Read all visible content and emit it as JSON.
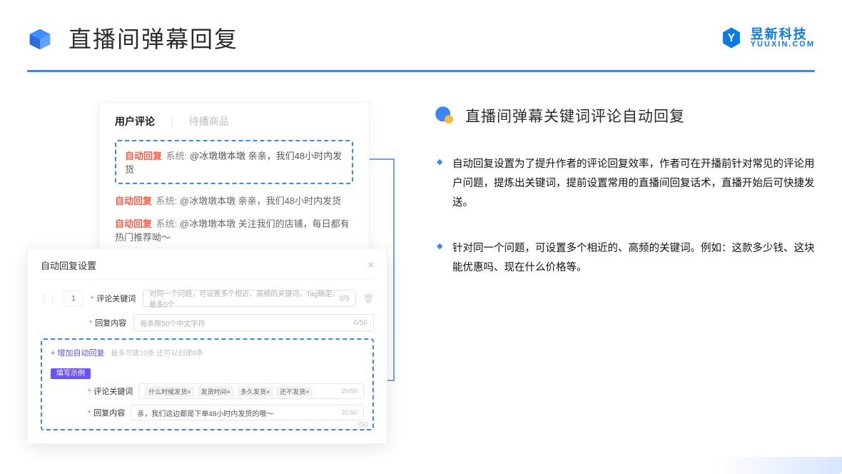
{
  "header": {
    "title": "直播间弹幕回复",
    "brand_cn": "昱新科技",
    "brand_en": "YUUXIN.COM"
  },
  "left": {
    "tabs": {
      "active": "用户评论",
      "other": "待播商品"
    },
    "highlighted_comment": {
      "tag": "自动回复",
      "sys": "系统: ",
      "text": "@冰墩墩本墩 亲亲，我们48小时内发货"
    },
    "comments": [
      {
        "tag": "自动回复",
        "sys": "系统: ",
        "text": "@冰墩墩本墩 亲亲，我们48小时内发货"
      },
      {
        "tag": "自动回复",
        "sys": "系统: ",
        "text": "@冰墩墩本墩 关注我们的店铺，每日都有热门推荐呦～"
      }
    ],
    "settings": {
      "title": "自动回复设置",
      "order": "1",
      "kw_label": "评论关键词",
      "kw_placeholder": "对同一个问题，可设置多个相近、高频的关键词，Tag确定，最多5个",
      "kw_count": "0/5",
      "content_label": "回复内容",
      "content_placeholder": "每条限50个中文字符",
      "content_count": "0/50",
      "add_link": "+ 增加自动回复",
      "add_hint": "最多可建10条 还可以创建9条",
      "example_badge": "填写示例",
      "ex_kw_label": "评论关键词",
      "ex_kw_chips": [
        "什么时候发货×",
        "发货时间×",
        "多久发货×",
        "还不发货×"
      ],
      "ex_kw_count": "20/50",
      "ex_content_label": "回复内容",
      "ex_content_value": "亲，我们这边都是下单48小时内发货的哦～",
      "ex_content_count": "37/50",
      "outer_trail": "/50"
    }
  },
  "right": {
    "section_title": "直播间弹幕关键词评论自动回复",
    "bullets": [
      "自动回复设置为了提升作者的评论回复效率，作者可在开播前针对常见的评论用户问题，提炼出关键词，提前设置常用的直播间回复话术，直播开始后可快捷发送。",
      "针对同一个问题，可设置多个相近的、高频的关键词。例如：这款多少钱、这块能优惠吗、现在什么价格等。"
    ]
  }
}
